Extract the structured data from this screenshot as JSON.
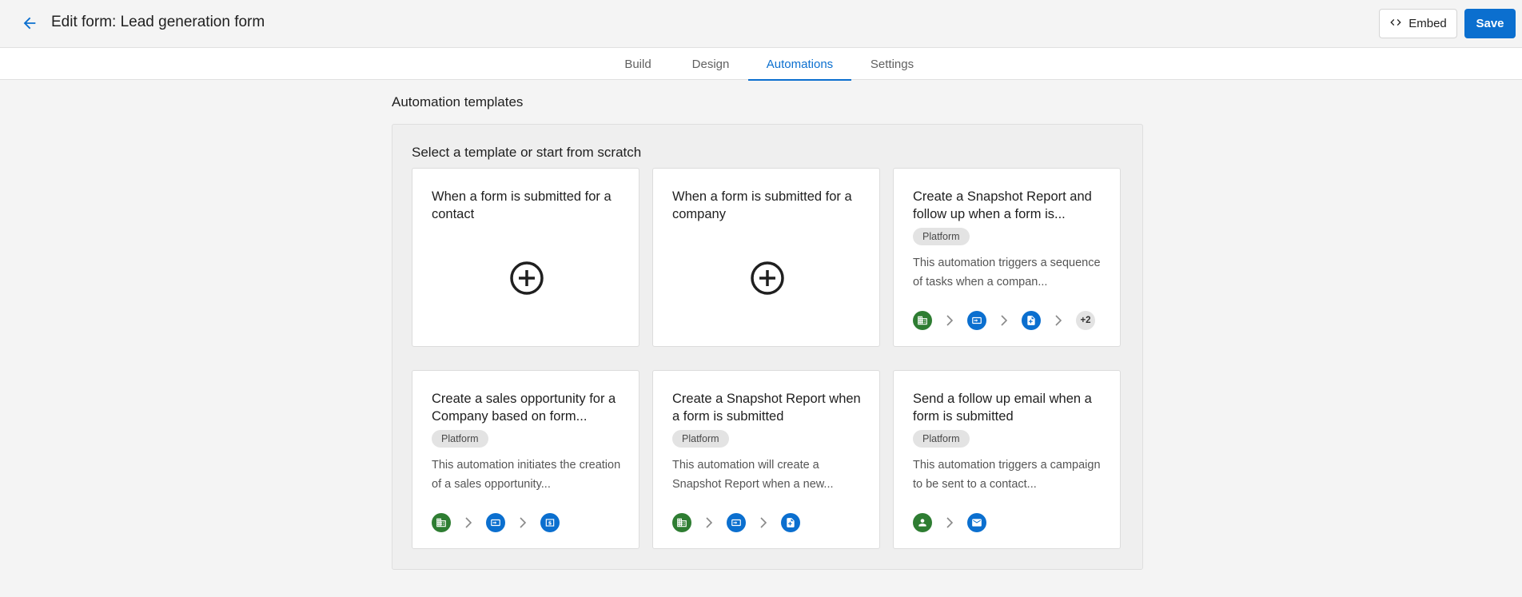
{
  "header": {
    "title": "Edit form: Lead generation form",
    "embed_label": "Embed",
    "save_label": "Save"
  },
  "tabs": [
    {
      "label": "Build",
      "active": false
    },
    {
      "label": "Design",
      "active": false
    },
    {
      "label": "Automations",
      "active": true
    },
    {
      "label": "Settings",
      "active": false
    }
  ],
  "section": {
    "title": "Automation templates",
    "subtitle": "Select a template or start from scratch"
  },
  "colors": {
    "accent": "#0b6fcf",
    "green": "#2e7d32"
  },
  "cards": [
    {
      "title": "When a form is submitted for a contact",
      "type": "blank",
      "icon": "add-circle-icon"
    },
    {
      "title": "When a form is submitted for a company",
      "type": "blank",
      "icon": "add-circle-icon"
    },
    {
      "title": "Create a Snapshot Report and follow up when a form is...",
      "badge": "Platform",
      "description": "This automation triggers a sequence of tasks when a compan...",
      "flow": [
        "company-icon",
        "form-submit-icon",
        "report-icon"
      ],
      "flow_more": "+2"
    },
    {
      "title": "Create a sales opportunity for a Company based on form...",
      "badge": "Platform",
      "description": "This automation initiates the creation of a sales opportunity...",
      "flow": [
        "company-icon",
        "form-submit-icon",
        "opportunity-icon"
      ]
    },
    {
      "title": "Create a Snapshot Report when a form is submitted",
      "badge": "Platform",
      "description": "This automation will create a Snapshot Report when a new...",
      "flow": [
        "company-icon",
        "form-submit-icon",
        "report-icon"
      ]
    },
    {
      "title": "Send a follow up email when a form is submitted",
      "badge": "Platform",
      "description": "This automation triggers a campaign to be sent to a contact...",
      "flow": [
        "contact-icon",
        "email-icon"
      ]
    }
  ]
}
